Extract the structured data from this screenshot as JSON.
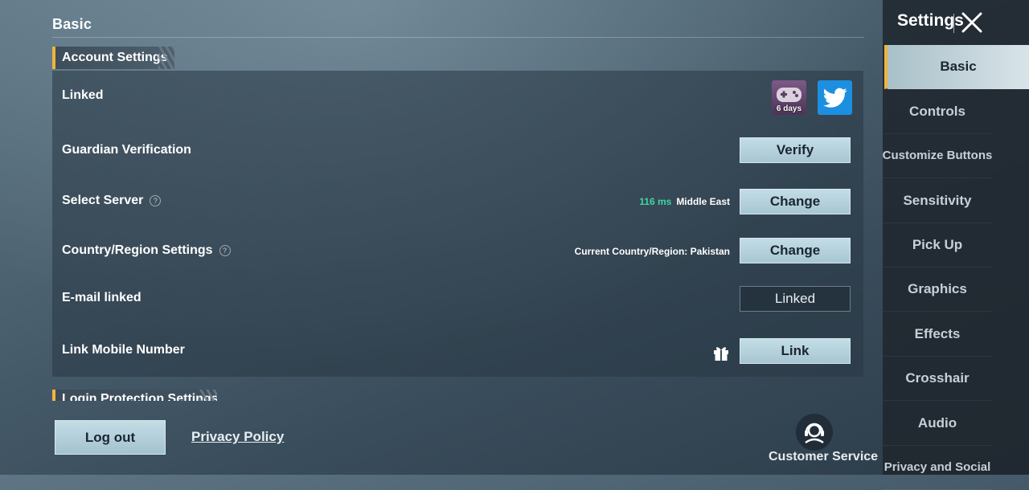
{
  "main": {
    "section_title": "Basic",
    "account_settings_label": "Account Settings",
    "next_section_label": "Login Protection Settings",
    "rows": {
      "linked": {
        "label": "Linked",
        "game_days": "6 days"
      },
      "guardian": {
        "label": "Guardian Verification",
        "button": "Verify"
      },
      "server": {
        "label": "Select Server",
        "ping": "116 ms",
        "region": "Middle East",
        "button": "Change"
      },
      "country": {
        "label": "Country/Region Settings",
        "current": "Current Country/Region: Pakistan",
        "button": "Change"
      },
      "email": {
        "label": "E-mail linked",
        "button": "Linked"
      },
      "mobile": {
        "label": "Link Mobile Number",
        "button": "Link"
      }
    },
    "help_glyph": "?"
  },
  "footer": {
    "logout": "Log out",
    "privacy": "Privacy Policy",
    "customer_service": "Customer Service"
  },
  "sidebar": {
    "title": "Settings",
    "items": [
      {
        "label": "Basic"
      },
      {
        "label": "Controls"
      },
      {
        "label": "Customize Buttons"
      },
      {
        "label": "Sensitivity"
      },
      {
        "label": "Pick Up"
      },
      {
        "label": "Graphics"
      },
      {
        "label": "Effects"
      },
      {
        "label": "Crosshair"
      },
      {
        "label": "Audio"
      },
      {
        "label": "Privacy and Social"
      }
    ]
  },
  "colors": {
    "accent": "#f0b43c",
    "ping": "#3ed6a6",
    "button": "#b5d2dc",
    "twitter": "#1d8fe0"
  },
  "icons": [
    "game-controller-icon",
    "twitter-icon",
    "gift-icon",
    "customer-service-icon",
    "close-icon",
    "help-icon"
  ]
}
